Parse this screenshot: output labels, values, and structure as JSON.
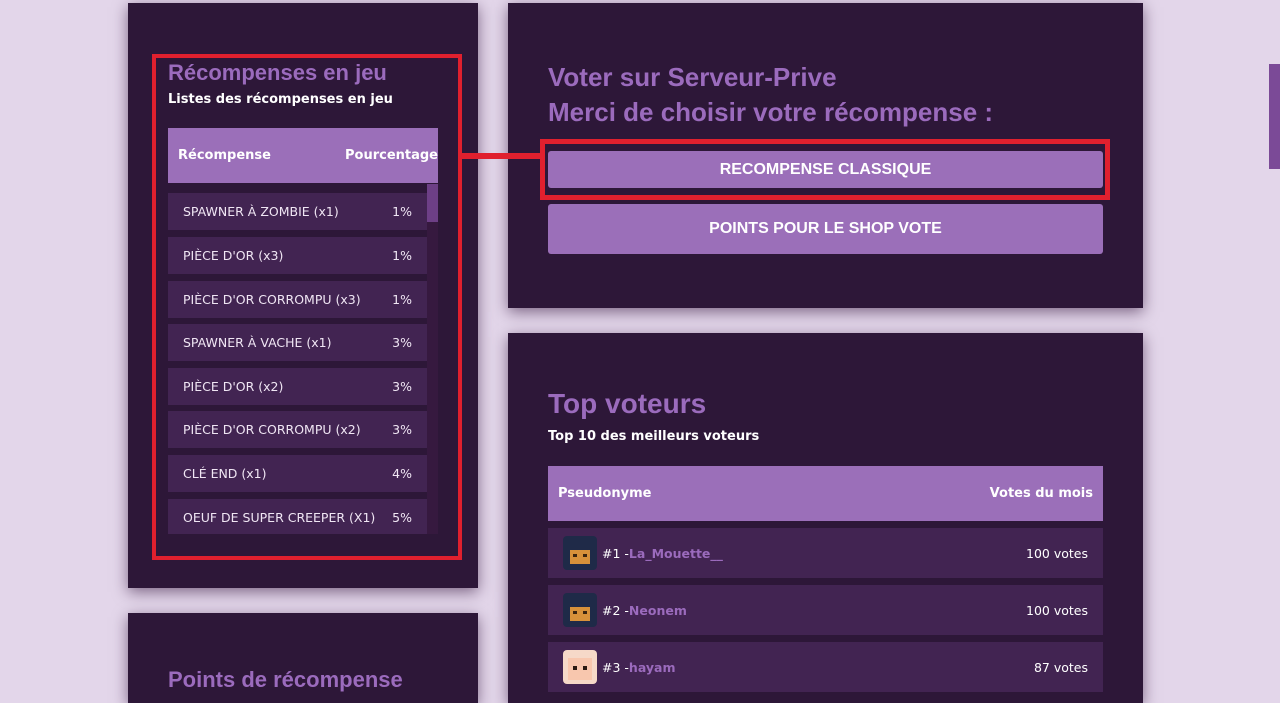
{
  "rewards": {
    "title": "Récompenses en jeu",
    "subtitle": "Listes des récompenses en jeu",
    "col_reward": "Récompense",
    "col_percent": "Pourcentage",
    "items": [
      {
        "name": "SPAWNER À ZOMBIE (x1)",
        "percent": "1%"
      },
      {
        "name": "PIÈCE D'OR (x3)",
        "percent": "1%"
      },
      {
        "name": "PIÈCE D'OR CORROMPU (x3)",
        "percent": "1%"
      },
      {
        "name": "SPAWNER À VACHE (x1)",
        "percent": "3%"
      },
      {
        "name": "PIÈCE D'OR (x2)",
        "percent": "3%"
      },
      {
        "name": "PIÈCE D'OR CORROMPU (x2)",
        "percent": "3%"
      },
      {
        "name": "CLÉ END (x1)",
        "percent": "4%"
      },
      {
        "name": "OEUF DE SUPER CREEPER (X1)",
        "percent": "5%"
      }
    ]
  },
  "points": {
    "title": "Points de récompense"
  },
  "vote": {
    "title_line1": "Voter sur Serveur-Prive",
    "title_line2": "Merci de choisir votre récompense :",
    "btn_classic": "RECOMPENSE CLASSIQUE",
    "btn_shop": "POINTS POUR LE SHOP VOTE"
  },
  "top": {
    "title": "Top voteurs",
    "subtitle": "Top 10 des meilleurs voteurs",
    "col_pseudo": "Pseudonyme",
    "col_votes": "Votes du mois",
    "voters": [
      {
        "rank": "#1 - ",
        "name": "La_Mouette__",
        "votes": "100 votes",
        "avatar": "dark-skin-avatar"
      },
      {
        "rank": "#2 - ",
        "name": "Neonem",
        "votes": "100 votes",
        "avatar": "dark-skin-avatar"
      },
      {
        "rank": "#3 - ",
        "name": "hayam",
        "votes": "87 votes",
        "avatar": "light-skin-avatar"
      }
    ]
  },
  "colors": {
    "background": "#e3d6ea",
    "card": "#2d1738",
    "accent": "#9b6fb9",
    "row": "#422452",
    "highlight": "#e0202e"
  }
}
